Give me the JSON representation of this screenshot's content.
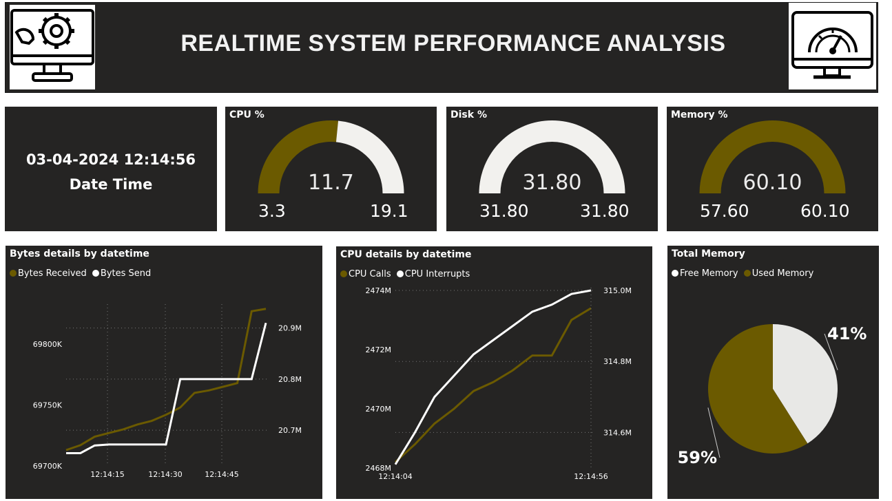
{
  "header": {
    "title": "REALTIME SYSTEM PERFORMANCE ANALYSIS",
    "left_icon": "settings-monitor-icon",
    "right_icon": "speedometer-monitor-icon"
  },
  "colors": {
    "background": "#252423",
    "accent": "#6b5a00",
    "light": "#f2f1ee"
  },
  "datetime_card": {
    "value": "03-04-2024 12:14:56",
    "label": "Date Time"
  },
  "gauges": [
    {
      "title": "CPU %",
      "value_label": "11.7",
      "min_label": "3.3",
      "max_label": "19.1",
      "value": 11.7,
      "min": 3.3,
      "max": 19.1
    },
    {
      "title": "Disk %",
      "value_label": "31.80",
      "min_label": "31.80",
      "max_label": "31.80",
      "value": 31.8,
      "min": 31.8,
      "max": 31.8
    },
    {
      "title": "Memory %",
      "value_label": "60.10",
      "min_label": "57.60",
      "max_label": "60.10",
      "value": 60.1,
      "min": 57.6,
      "max": 60.1
    }
  ],
  "bytes_chart": {
    "title": "Bytes details by datetime",
    "legend": [
      "Bytes Received",
      "Bytes Send"
    ],
    "left_ticks": [
      "69800K",
      "69750K",
      "69700K"
    ],
    "right_ticks": [
      "20.9M",
      "20.8M",
      "20.7M"
    ],
    "x_ticks": [
      "12:14:15",
      "12:14:30",
      "12:14:45"
    ]
  },
  "cpu_chart": {
    "title": "CPU details by datetime",
    "legend": [
      "CPU Calls",
      "CPU Interrupts"
    ],
    "left_ticks": [
      "2474M",
      "2472M",
      "2470M",
      "2468M"
    ],
    "right_ticks": [
      "315.0M",
      "314.8M",
      "314.6M"
    ],
    "x_ticks": [
      "12:14:04",
      "12:14:56"
    ]
  },
  "memory_pie": {
    "title": "Total Memory",
    "legend": [
      "Free Memory",
      "Used Memory"
    ],
    "free_label": "41%",
    "used_label": "59%"
  },
  "chart_data": [
    {
      "type": "line",
      "title": "Bytes details by datetime",
      "x": [
        "12:14:04",
        "12:14:08",
        "12:14:12",
        "12:14:15",
        "12:14:20",
        "12:14:25",
        "12:14:30",
        "12:14:34",
        "12:14:37",
        "12:14:40",
        "12:14:45",
        "12:14:50",
        "12:14:53",
        "12:14:55",
        "12:14:56"
      ],
      "series": [
        {
          "name": "Bytes Received",
          "axis": "left",
          "values": [
            69713,
            69717,
            69724,
            69727,
            69730,
            69734,
            69737,
            69742,
            69748,
            69760,
            69762,
            69765,
            69768,
            69827,
            69829
          ]
        },
        {
          "name": "Bytes Send",
          "axis": "right",
          "values": [
            20.655,
            20.655,
            20.67,
            20.672,
            20.672,
            20.672,
            20.672,
            20.672,
            20.8,
            20.8,
            20.8,
            20.8,
            20.8,
            20.8,
            20.91
          ]
        }
      ],
      "ylim_left": [
        69700,
        69830
      ],
      "ylim_right": [
        20.63,
        20.94
      ]
    },
    {
      "type": "line",
      "title": "CPU details by datetime",
      "x": [
        "12:14:04",
        "12:14:10",
        "12:14:16",
        "12:14:22",
        "12:14:28",
        "12:14:34",
        "12:14:40",
        "12:14:46",
        "12:14:50",
        "12:14:53",
        "12:14:56"
      ],
      "series": [
        {
          "name": "CPU Calls",
          "axis": "left",
          "values": [
            2468.2,
            2468.8,
            2469.5,
            2470.0,
            2470.6,
            2470.9,
            2471.3,
            2471.8,
            2471.8,
            2473.0,
            2473.4
          ]
        },
        {
          "name": "CPU Interrupts",
          "axis": "right",
          "values": [
            314.51,
            314.6,
            314.7,
            314.76,
            314.82,
            314.86,
            314.9,
            314.94,
            314.96,
            314.99,
            315.0
          ]
        }
      ],
      "ylim_left": [
        2468,
        2474
      ],
      "ylim_right": [
        314.5,
        315.0
      ]
    },
    {
      "type": "pie",
      "title": "Total Memory",
      "categories": [
        "Free Memory",
        "Used Memory"
      ],
      "values": [
        41,
        59
      ]
    }
  ]
}
